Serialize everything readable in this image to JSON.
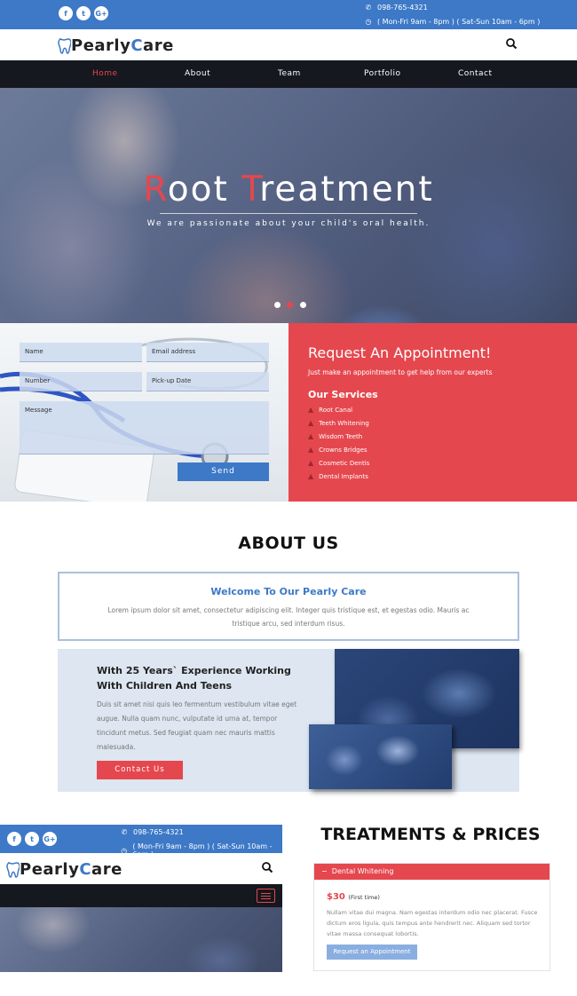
{
  "topbar": {
    "social": [
      "f",
      "t",
      "G+"
    ],
    "phone": "098-765-4321",
    "hours": "( Mon-Fri 9am - 8pm ) ( Sat-Sun 10am - 6pm )"
  },
  "logo": {
    "part1": "Pearly ",
    "accent": "C",
    "part2": "are"
  },
  "nav": [
    "Home",
    "About",
    "Team",
    "Portfolio",
    "Contact"
  ],
  "hero": {
    "title_r": "R",
    "title_rest1": "oot ",
    "title_t": "T",
    "title_rest2": "reatment",
    "subtitle": "We are passionate about your child's oral health."
  },
  "form": {
    "name": "Name",
    "email": "Email address",
    "number": "Number",
    "pickup": "Pick-up Date",
    "message": "Message",
    "send": "Send"
  },
  "appointment": {
    "title": "Request An Appointment!",
    "subtitle": "Just make an appointment to get help from our experts",
    "services_heading": "Our Services",
    "services": [
      "Root Canal",
      "Teeth Whitening",
      "Wisdom Teeth",
      "Crowns Bridges",
      "Cosmetic Dentis",
      "Dental Implants"
    ]
  },
  "about": {
    "heading": "ABOUT US",
    "welcome_title": "Welcome To Our Pearly Care",
    "welcome_text": "Lorem ipsum dolor sit amet, consectetur adipiscing elit. Integer quis tristique est, et egestas odio. Mauris ac tristique arcu, sed interdum risus.",
    "exp_title": "With 25 Years` Experience Working With Children And Teens",
    "exp_text": "Duis sit amet nisi quis leo fermentum vestibulum vitae eget augue. Nulla quam nunc, vulputate id urna at, tempor tincidunt metus. Sed feugiat quam nec mauris mattis malesuada.",
    "contact_btn": "Contact Us"
  },
  "treatments": {
    "heading": "TREATMENTS & PRICES",
    "item": "Dental Whitening",
    "toggle": "−",
    "price": "$30",
    "price_note": "(First time)",
    "desc": "Nullam vitae dui magna. Nam egestas interdum odio nec placerat. Fusce dictum eros ligula, quis tempus ante hendrerit nec. Aliquam sed tortor vitae massa consequat lobortis.",
    "button": "Request an Appointment"
  }
}
